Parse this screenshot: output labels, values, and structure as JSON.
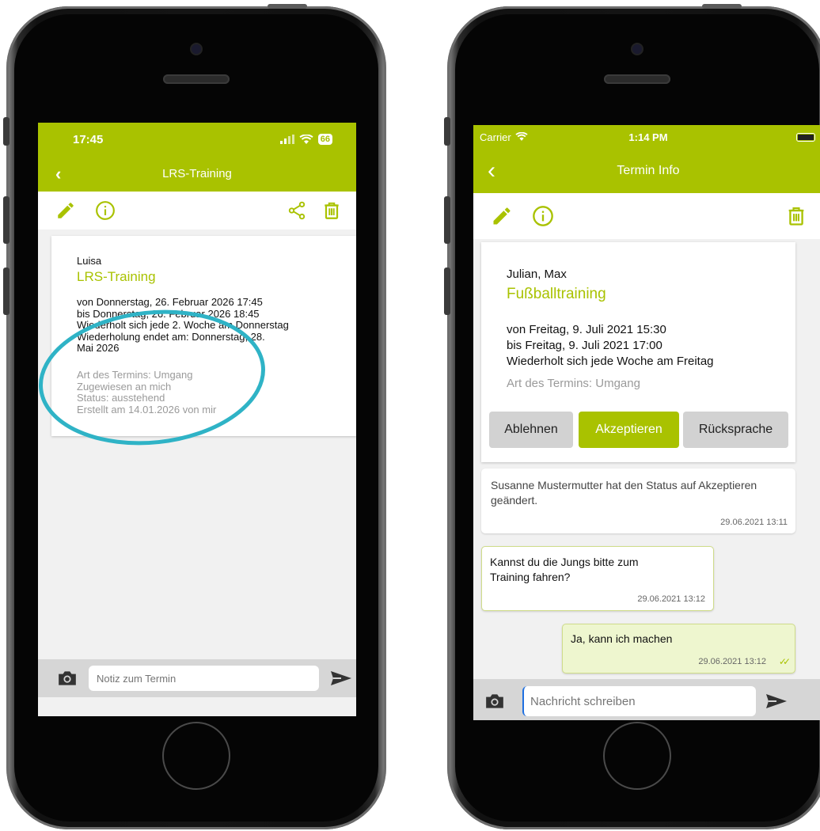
{
  "left": {
    "status_time": "17:45",
    "battery": "66",
    "nav_title": "LRS-Training",
    "card": {
      "participant": "Luisa",
      "title": "LRS-Training",
      "lines": [
        "von Donnerstag, 26. Februar 2026 17:45",
        "bis Donnerstag, 26. Februar 2026 18:45",
        "Wiederholt sich jede 2. Woche am Donnerstag",
        "Wiederholung endet am: Donnerstag, 28.",
        "Mai 2026"
      ],
      "meta": [
        "Art des Termins: Umgang",
        "Zugewiesen an mich",
        "Status: ausstehend",
        "Erstellt am 14.01.2026 von mir"
      ]
    },
    "input_placeholder": "Notiz zum Termin"
  },
  "right": {
    "carrier": "Carrier",
    "status_time": "1:14 PM",
    "nav_title": "Termin Info",
    "card": {
      "participants": "Julian, Max",
      "title": "Fußballtraining",
      "lines": [
        "von Freitag, 9. Juli 2021 15:30",
        "bis Freitag, 9. Juli 2021 17:00",
        "Wiederholt sich jede  Woche am Freitag"
      ],
      "meta": "Art des Termins: Umgang"
    },
    "buttons": {
      "decline": "Ablehnen",
      "accept": "Akzeptieren",
      "consult": "Rücksprache"
    },
    "messages": [
      {
        "text": "Susanne Mustermutter hat den Status auf Akzeptieren geändert.",
        "time": "29.06.2021 13:11"
      },
      {
        "text": "Kannst du die Jungs bitte zum Training fahren?",
        "time": "29.06.2021 13:12"
      },
      {
        "text": "Ja, kann ich machen",
        "time": "29.06.2021 13:12"
      }
    ],
    "input_placeholder": "Nachricht schreiben"
  },
  "colors": {
    "accent": "#a9c200",
    "highlight_ring": "#2fb3c6"
  }
}
